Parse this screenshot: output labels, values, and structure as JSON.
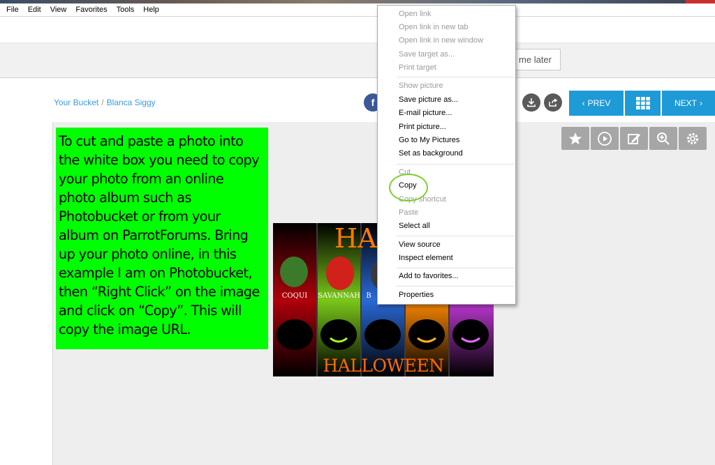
{
  "menubar": {
    "items": [
      "File",
      "Edit",
      "View",
      "Favorites",
      "Tools",
      "Help"
    ]
  },
  "banner": {
    "remind_label": "d me later"
  },
  "breadcrumb": {
    "root": "Your Bucket",
    "separator": "/",
    "current": "Blanca Siggy"
  },
  "share": {
    "facebook_label": "f"
  },
  "nav": {
    "prev_label": "PREV",
    "next_label": "NEXT",
    "prev_icon": "‹",
    "next_icon": "›"
  },
  "tools": [
    "star-icon",
    "play-icon",
    "edit-icon",
    "zoom-icon",
    "gear-icon"
  ],
  "note": {
    "lines": [
      "To cut and paste a photo into",
      "the white box you need to copy",
      "your photo from an online",
      "photo album such as",
      "Photobucket or from your",
      "album on ParrotForums.  Bring",
      "up your photo online, in this",
      "example I am on Photobucket,",
      "then “Right Click” on the image",
      "and click on “Copy”. This will",
      "copy the image URL."
    ]
  },
  "image": {
    "title_partial": "HA",
    "names": [
      "COQUI",
      "SAVANNAH",
      "B"
    ],
    "bottom_title": "HALLOWEEN"
  },
  "context_menu": {
    "items": [
      {
        "label": "Open link",
        "enabled": false
      },
      {
        "label": "Open link in new tab",
        "enabled": false
      },
      {
        "label": "Open link in new window",
        "enabled": false
      },
      {
        "label": "Save target as...",
        "enabled": false
      },
      {
        "label": "Print target",
        "enabled": false
      },
      {
        "label": "Show picture",
        "enabled": false
      },
      {
        "label": "Save picture as...",
        "enabled": true
      },
      {
        "label": "E-mail picture...",
        "enabled": true
      },
      {
        "label": "Print picture...",
        "enabled": true
      },
      {
        "label": "Go to My Pictures",
        "enabled": true
      },
      {
        "label": "Set as background",
        "enabled": true
      },
      {
        "label": "Cut",
        "enabled": false
      },
      {
        "label": "Copy",
        "enabled": true
      },
      {
        "label": "Copy shortcut",
        "enabled": false
      },
      {
        "label": "Paste",
        "enabled": false
      },
      {
        "label": "Select all",
        "enabled": true
      },
      {
        "label": "View source",
        "enabled": true
      },
      {
        "label": "Inspect element",
        "enabled": true
      },
      {
        "label": "Add to favorites...",
        "enabled": true
      },
      {
        "label": "Properties",
        "enabled": true
      }
    ]
  },
  "colors": {
    "accent": "#1e9ad6",
    "note_bg": "#00ff00",
    "highlight_ring": "#7bd22a",
    "facebook": "#3b5998"
  }
}
